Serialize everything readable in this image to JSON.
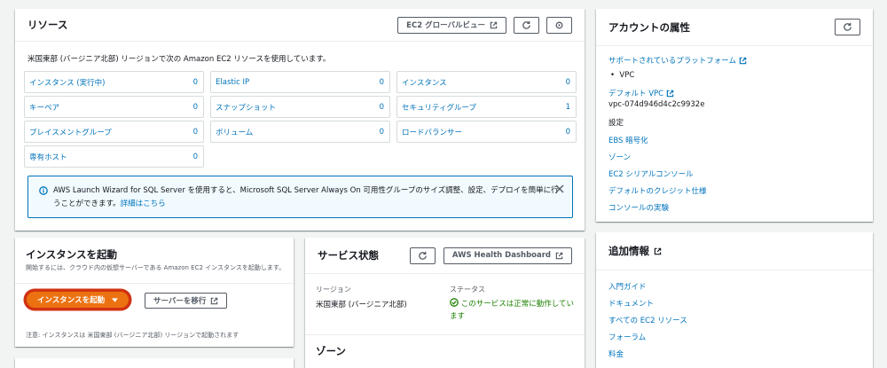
{
  "resources": {
    "title": "リソース",
    "global_view_label": "EC2 グローバルビュー",
    "description": "米国東部 (バージニア北部) リージョンで次の Amazon EC2 リソースを使用しています。",
    "cells": [
      {
        "label": "インスタンス (実行中)",
        "count": "0"
      },
      {
        "label": "Elastic IP",
        "count": "0"
      },
      {
        "label": "インスタンス",
        "count": "0"
      },
      {
        "label": "キーペア",
        "count": "0"
      },
      {
        "label": "スナップショット",
        "count": "0"
      },
      {
        "label": "セキュリティグループ",
        "count": "1"
      },
      {
        "label": "プレイスメントグループ",
        "count": "0"
      },
      {
        "label": "ボリューム",
        "count": "0"
      },
      {
        "label": "ロードバランサー",
        "count": "0"
      },
      {
        "label": "専有ホスト",
        "count": "0"
      }
    ],
    "alert": {
      "message": "AWS Launch Wizard for SQL Server を使用すると、Microsoft SQL Server Always On 可用性グループのサイズ調整、設定、デプロイを簡単に行うことができます。",
      "link": "詳細はこちら"
    }
  },
  "account": {
    "title": "アカウントの属性",
    "supported_platforms": "サポートされているプラットフォーム",
    "vpc_bullet": "VPC",
    "default_vpc_label": "デフォルト VPC",
    "default_vpc_id": "vpc-074d946d4c2c9932e",
    "settings_label": "設定",
    "settings_links": [
      "EBS 暗号化",
      "ゾーン",
      "EC2 シリアルコンソール",
      "デフォルトのクレジット仕様",
      "コンソールの実験"
    ]
  },
  "launch": {
    "title": "インスタンスを起動",
    "subtitle": "開始するには、クラウド内の仮想サーバーである Amazon EC2 インスタンスを起動します。",
    "launch_button": "インスタンスを起動",
    "migrate_button": "サーバーを移行",
    "note": "注意: インスタンスは 米国東部 (バージニア北部) リージョンで起動されます"
  },
  "service": {
    "title": "サービス状態",
    "health_button": "AWS Health Dashboard",
    "region_label": "リージョン",
    "region_value": "米国東部 (バージニア北部)",
    "status_label": "ステータス",
    "status_value": "このサービスは正常に動作しています",
    "zone_title": "ゾーン"
  },
  "more_info": {
    "title": "追加情報",
    "links": [
      "入門ガイド",
      "ドキュメント",
      "すべての EC2 リソース",
      "フォーラム",
      "料金"
    ]
  },
  "colors": {
    "link": "#0073bb",
    "primary": "#ec7211",
    "highlight": "#d13212",
    "success": "#1d8102",
    "info_bg": "#f1faff"
  }
}
